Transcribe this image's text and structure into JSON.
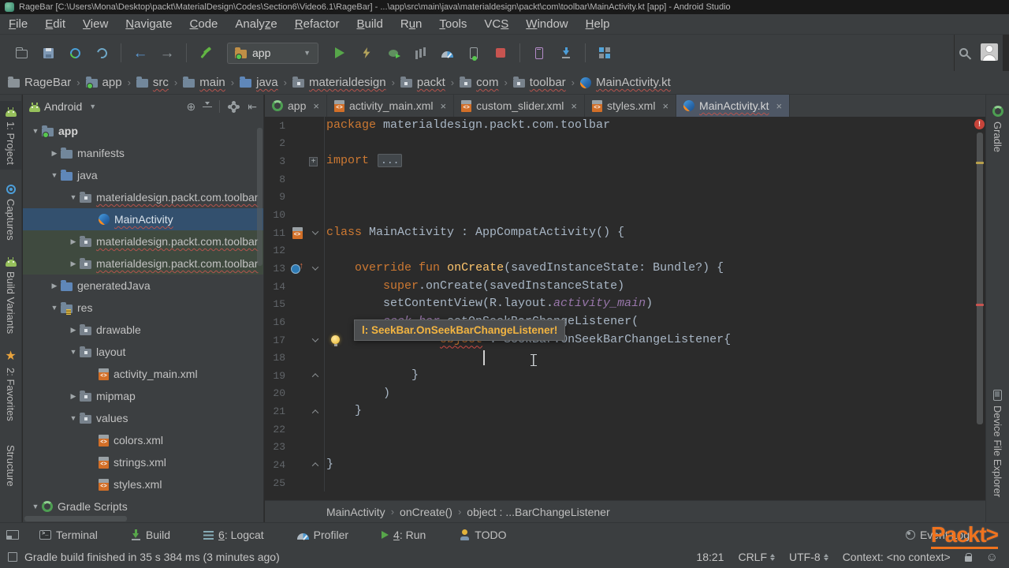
{
  "colors": {
    "accent_blue": "#4aa0d8",
    "keyword": "#cc7832",
    "function_decl": "#ffc66d",
    "property": "#9876aa",
    "error": "#cf4b44",
    "selection_row": "#33506e",
    "test_source_row": "#3f4a3f",
    "tooltip_text": "#f2b441",
    "packt_orange": "#f0731e",
    "run_green": "#57a64a",
    "stop_red": "#c75450"
  },
  "window": {
    "title": "RageBar [C:\\Users\\Mona\\Desktop\\packt\\MaterialDesign\\Codes\\Section6\\Video6.1\\RageBar] - ...\\app\\src\\main\\java\\materialdesign\\packt\\com\\toolbar\\MainActivity.kt [app] - Android Studio"
  },
  "menubar": [
    {
      "label": "File",
      "mnemonic": 0
    },
    {
      "label": "Edit",
      "mnemonic": 0
    },
    {
      "label": "View",
      "mnemonic": 0
    },
    {
      "label": "Navigate",
      "mnemonic": 0
    },
    {
      "label": "Code",
      "mnemonic": 0
    },
    {
      "label": "Analyze",
      "mnemonic": 5
    },
    {
      "label": "Refactor",
      "mnemonic": 0
    },
    {
      "label": "Build",
      "mnemonic": 0
    },
    {
      "label": "Run",
      "mnemonic": 1
    },
    {
      "label": "Tools",
      "mnemonic": 0
    },
    {
      "label": "VCS",
      "mnemonic": 2
    },
    {
      "label": "Window",
      "mnemonic": 0
    },
    {
      "label": "Help",
      "mnemonic": 0
    }
  ],
  "toolbar": {
    "run_config": "app",
    "items": [
      {
        "icon": "openf",
        "name": "open-file"
      },
      {
        "icon": "save",
        "name": "save-all"
      },
      {
        "icon": "sync",
        "name": "sync-project-gradle"
      },
      {
        "icon": "refresh",
        "name": "sync"
      },
      {
        "type": "sep"
      },
      {
        "icon": "back",
        "name": "navigate-back"
      },
      {
        "icon": "forward",
        "name": "navigate-forward"
      },
      {
        "type": "sep"
      },
      {
        "icon": "hammer",
        "name": "make-project"
      },
      {
        "type": "runconfig"
      },
      {
        "icon": "run",
        "name": "run-app"
      },
      {
        "icon": "lightning",
        "name": "apply-changes"
      },
      {
        "icon": "debug",
        "name": "debug-app"
      },
      {
        "icon": "bars",
        "name": "profile-app"
      },
      {
        "icon": "gauge",
        "name": "profiler"
      },
      {
        "icon": "devicerun",
        "name": "attach-debugger"
      },
      {
        "icon": "stop",
        "name": "stop-app"
      },
      {
        "type": "sep"
      },
      {
        "icon": "avd",
        "name": "avd-manager"
      },
      {
        "icon": "sdk",
        "name": "sdk-manager"
      },
      {
        "type": "sep"
      },
      {
        "icon": "inspector",
        "name": "layout-inspector"
      }
    ]
  },
  "toolbar_right": [
    {
      "icon": "search",
      "name": "search-everywhere"
    },
    {
      "icon": "avatar",
      "name": "user-avatar"
    }
  ],
  "file_breadcrumbs": [
    {
      "label": "RageBar",
      "icon": "fgray"
    },
    {
      "label": "app",
      "icon": "modfolder"
    },
    {
      "label": "src",
      "icon": "fsteel",
      "squiggle": true
    },
    {
      "label": "main",
      "icon": "fsteel",
      "squiggle": true
    },
    {
      "label": "java",
      "icon": "fblue",
      "squiggle": true
    },
    {
      "label": "materialdesign",
      "icon": "pkg",
      "squiggle": true
    },
    {
      "label": "packt",
      "icon": "pkg",
      "squiggle": true
    },
    {
      "label": "com",
      "icon": "pkg",
      "squiggle": true
    },
    {
      "label": "toolbar",
      "icon": "pkg",
      "squiggle": true
    },
    {
      "label": "MainActivity.kt",
      "icon": "kt",
      "squiggle": true
    }
  ],
  "left_stripe": [
    {
      "label": "1: Project",
      "icon": "and",
      "active": true
    },
    {
      "label": "Captures",
      "icon": "capture"
    },
    {
      "label": "Build Variants",
      "icon": "and"
    },
    {
      "label": "2: Favorites",
      "icon": "star"
    },
    {
      "label": "Structure"
    }
  ],
  "right_stripe": [
    {
      "label": "Gradle",
      "icon": "gr"
    },
    {
      "label": "Device File Explorer",
      "icon": "device"
    }
  ],
  "project_panel": {
    "view": "Android",
    "tree": [
      {
        "label": "app",
        "level": 0,
        "arrow": "down",
        "icon": "modfolder",
        "bold": true
      },
      {
        "label": "manifests",
        "level": 1,
        "arrow": "right",
        "icon": "fsteel"
      },
      {
        "label": "java",
        "level": 1,
        "arrow": "down",
        "icon": "fblue"
      },
      {
        "label": "materialdesign.packt.com.toolbar",
        "level": 2,
        "arrow": "down",
        "icon": "pkg",
        "squiggle": true
      },
      {
        "label": "MainActivity",
        "level": 3,
        "icon": "kt",
        "selected": true,
        "squiggle": true
      },
      {
        "label": "materialdesign.packt.com.toolbar",
        "level": 2,
        "arrow": "right",
        "icon": "pkg",
        "green": true,
        "squiggle": true
      },
      {
        "label": "materialdesign.packt.com.toolbar",
        "level": 2,
        "arrow": "right",
        "icon": "pkg",
        "green": true,
        "squiggle": true
      },
      {
        "label": "generatedJava",
        "level": 1,
        "arrow": "right",
        "icon": "fblue"
      },
      {
        "label": "res",
        "level": 1,
        "arrow": "down",
        "icon": "fres"
      },
      {
        "label": "drawable",
        "level": 2,
        "arrow": "right",
        "icon": "pkg"
      },
      {
        "label": "layout",
        "level": 2,
        "arrow": "down",
        "icon": "pkg"
      },
      {
        "label": "activity_main.xml",
        "level": 3,
        "icon": "xml"
      },
      {
        "label": "mipmap",
        "level": 2,
        "arrow": "right",
        "icon": "pkg"
      },
      {
        "label": "values",
        "level": 2,
        "arrow": "down",
        "icon": "pkg"
      },
      {
        "label": "colors.xml",
        "level": 3,
        "icon": "xml"
      },
      {
        "label": "strings.xml",
        "level": 3,
        "icon": "xml"
      },
      {
        "label": "styles.xml",
        "level": 3,
        "icon": "xml"
      },
      {
        "label": "Gradle Scripts",
        "level": 0,
        "arrow": "down",
        "icon": "gr"
      }
    ]
  },
  "editor": {
    "tabs": [
      {
        "label": "app",
        "icon": "gr"
      },
      {
        "label": "activity_main.xml",
        "icon": "xml"
      },
      {
        "label": "custom_slider.xml",
        "icon": "xml"
      },
      {
        "label": "styles.xml",
        "icon": "xml"
      },
      {
        "label": "MainActivity.kt",
        "icon": "kt",
        "active": true,
        "squiggle": true
      }
    ],
    "tooltip": "l: SeekBar.OnSeekBarChangeListener!",
    "breadcrumbs": [
      "MainActivity",
      "onCreate()",
      "object : ...BarChangeListener"
    ],
    "lines": [
      {
        "n": "1",
        "parts": [
          [
            "k",
            "package"
          ],
          [
            "t",
            " materialdesign.packt.com.toolbar"
          ]
        ]
      },
      {
        "n": "2"
      },
      {
        "n": "3",
        "fold": "plus",
        "parts": [
          [
            "k",
            "import"
          ],
          [
            "t",
            " "
          ],
          [
            "pill",
            "..."
          ]
        ]
      },
      {
        "n": "8"
      },
      {
        "n": "9"
      },
      {
        "n": "10"
      },
      {
        "n": "11",
        "gicon": "xml",
        "fold": "down",
        "parts": [
          [
            "k",
            "class"
          ],
          [
            "t",
            " MainActivity : AppCompatActivity() {"
          ]
        ]
      },
      {
        "n": "12"
      },
      {
        "n": "13",
        "gicon": "ovr",
        "fold": "down",
        "parts": [
          [
            "t",
            "    "
          ],
          [
            "k",
            "override"
          ],
          [
            "t",
            " "
          ],
          [
            "k",
            "fun"
          ],
          [
            "t",
            " "
          ],
          [
            "f",
            "onCreate"
          ],
          [
            "t",
            "(savedInstanceState: Bundle?) {"
          ]
        ]
      },
      {
        "n": "14",
        "parts": [
          [
            "t",
            "        "
          ],
          [
            "k",
            "super"
          ],
          [
            "t",
            ".onCreate(savedInstanceState)"
          ]
        ]
      },
      {
        "n": "15",
        "parts": [
          [
            "t",
            "        setContentView(R.layout."
          ],
          [
            "p",
            "activity_main"
          ],
          [
            "t",
            ")"
          ]
        ]
      },
      {
        "n": "16",
        "parts": [
          [
            "t",
            "        "
          ],
          [
            "p",
            "seek_bar"
          ],
          [
            "t",
            ".setOnSeekBarChangeListener("
          ]
        ]
      },
      {
        "n": "17",
        "fold": "down",
        "bulb": true,
        "parts": [
          [
            "t",
            "                "
          ],
          [
            "ke",
            "object"
          ],
          [
            "t",
            " : SeekBar.OnSeekBarChangeListener{"
          ]
        ]
      },
      {
        "n": "18",
        "caret": 22
      },
      {
        "n": "19",
        "fold": "up",
        "parts": [
          [
            "t",
            "            }"
          ]
        ]
      },
      {
        "n": "20",
        "parts": [
          [
            "t",
            "        )"
          ]
        ]
      },
      {
        "n": "21",
        "fold": "up",
        "parts": [
          [
            "t",
            "    }"
          ]
        ]
      },
      {
        "n": "22"
      },
      {
        "n": "23"
      },
      {
        "n": "24",
        "fold": "up",
        "parts": [
          [
            "t",
            "}"
          ]
        ]
      },
      {
        "n": "25"
      }
    ]
  },
  "bottom_bar": {
    "items": [
      {
        "icon": "terminal",
        "label": "Terminal"
      },
      {
        "icon": "buildarrow",
        "label": "Build"
      },
      {
        "icon": "logcat",
        "num": "6",
        "label": "Logcat"
      },
      {
        "icon": "gauge",
        "label": "Profiler"
      },
      {
        "icon": "runsmall",
        "num": "4",
        "label": "Run"
      },
      {
        "icon": "todo",
        "label": "TODO"
      }
    ],
    "event_log": "Event Log"
  },
  "status_bar": {
    "message": "Gradle build finished in 35 s 384 ms (3 minutes ago)",
    "caret_position": "18:21",
    "line_separator": "CRLF",
    "encoding": "UTF-8",
    "context": "Context: <no context>"
  },
  "watermark": {
    "text": "Packt",
    "symbol": ">"
  }
}
